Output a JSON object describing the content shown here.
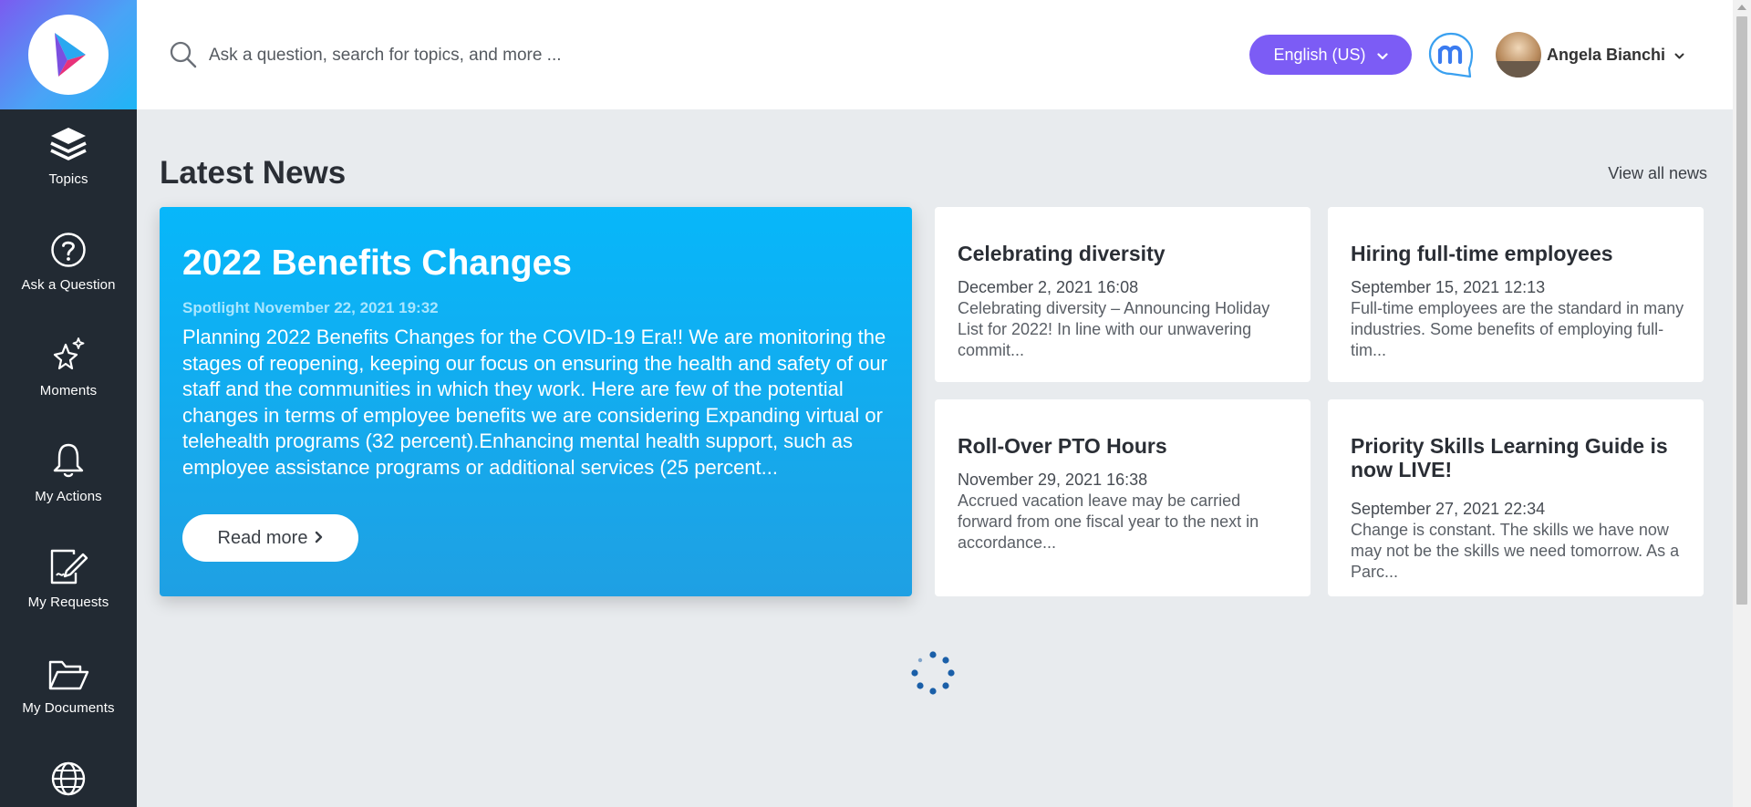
{
  "sidebar": {
    "items": [
      {
        "label": "Topics",
        "icon": "layers-icon"
      },
      {
        "label": "Ask a Question",
        "icon": "question-circle-icon"
      },
      {
        "label": "Moments",
        "icon": "sparkles-icon"
      },
      {
        "label": "My Actions",
        "icon": "bell-icon"
      },
      {
        "label": "My Requests",
        "icon": "edit-document-icon"
      },
      {
        "label": "My Documents",
        "icon": "folder-open-icon"
      },
      {
        "label": "",
        "icon": "globe-icon"
      }
    ]
  },
  "header": {
    "search_placeholder": "Ask a question, search for topics, and more ...",
    "language": "English (US)",
    "user_name": "Angela Bianchi",
    "colors": {
      "accent": "#7c5cf5",
      "chat_brand": "#3aa0f0"
    }
  },
  "news": {
    "section_title": "Latest News",
    "view_all": "View all news",
    "featured": {
      "title": "2022 Benefits Changes",
      "meta": "Spotlight November 22, 2021 19:32",
      "body": "Planning 2022 Benefits Changes for the COVID-19 Era!! We are monitoring the stages of reopening, keeping our focus on ensuring the health and safety of our staff and the communities in which they work. Here are few of the potential changes in terms of employee benefits we are considering Expanding virtual or telehealth programs (32 percent).Enhancing mental health support, such as employee assistance programs or additional services (25 percent...",
      "read_more": "Read more"
    },
    "cards": [
      {
        "title": "Celebrating diversity",
        "date": "December 2, 2021 16:08",
        "excerpt": "Celebrating diversity – Announcing Holiday List for 2022! In line with our unwavering commit..."
      },
      {
        "title": "Hiring full-time employees",
        "date": "September 15, 2021 12:13",
        "excerpt": "Full-time employees are the standard in many industries. Some benefits of employing full-tim..."
      },
      {
        "title": "Roll-Over PTO Hours",
        "date": "November 29, 2021 16:38",
        "excerpt": "Accrued vacation leave may be carried forward from one fiscal year to the next in accordance..."
      },
      {
        "title": "Priority Skills Learning Guide is now LIVE!",
        "date": "September 27, 2021 22:34",
        "excerpt": "Change is constant. The skills we have now may not be the skills we need tomorrow. As a Parc..."
      }
    ]
  }
}
